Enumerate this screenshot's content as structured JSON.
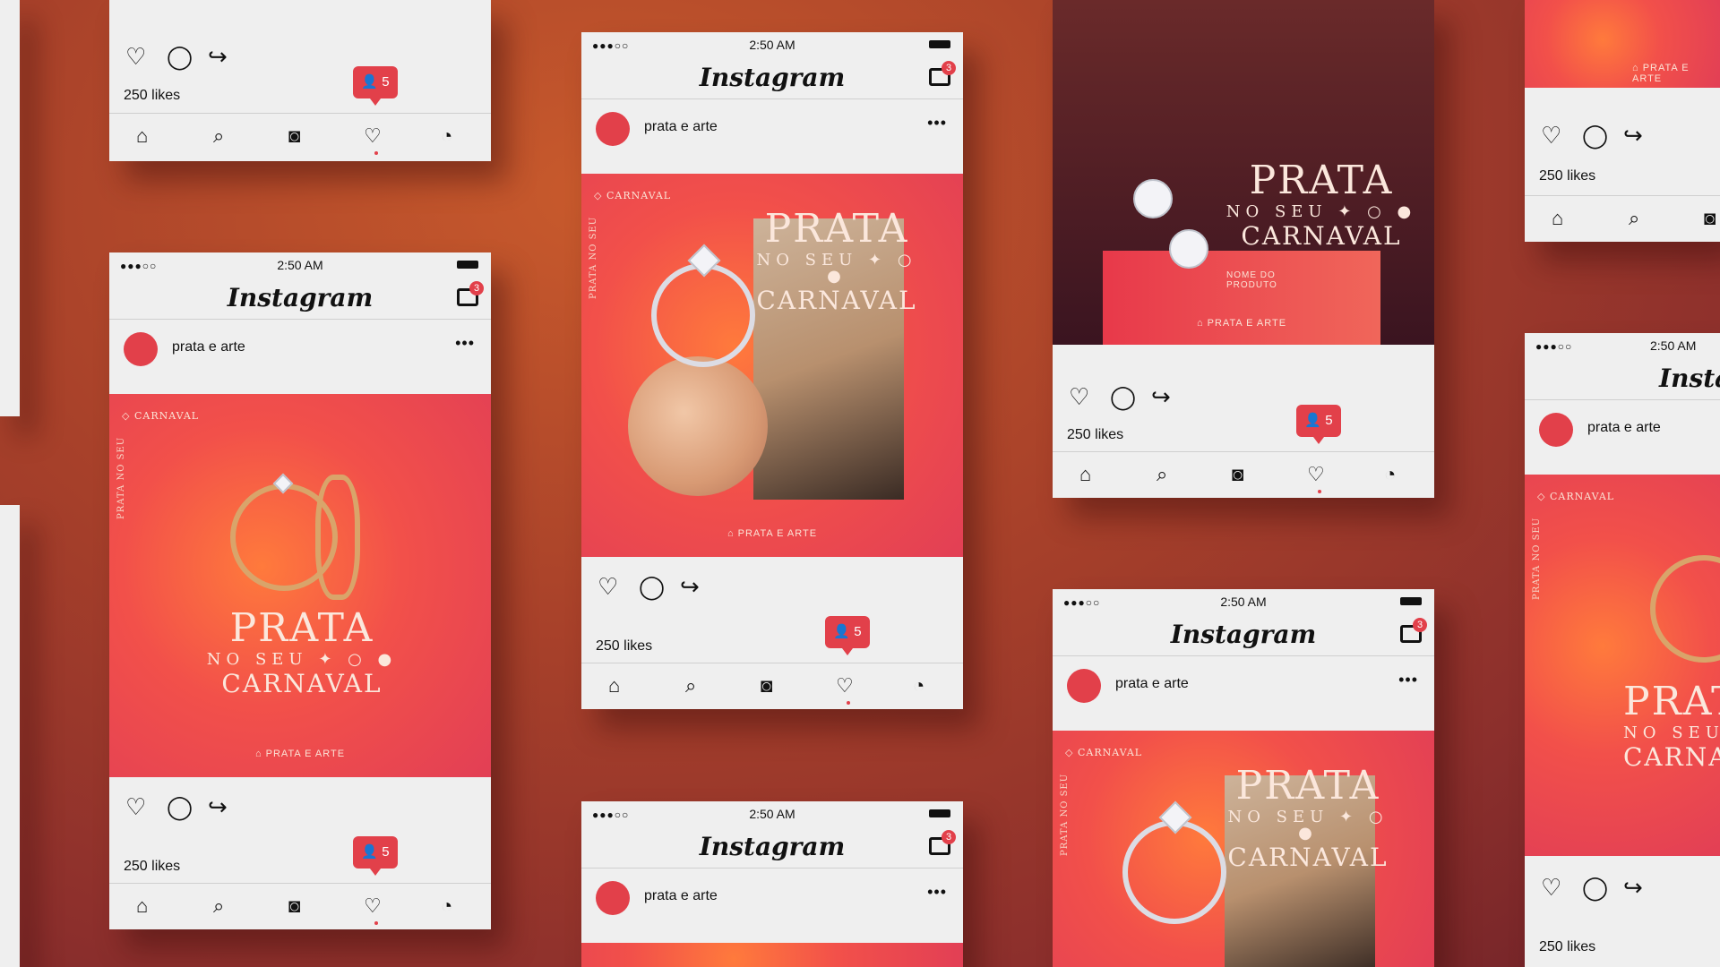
{
  "status": {
    "time": "2:50 AM",
    "signal": "●●●○○"
  },
  "app": {
    "name": "Instagram",
    "inbox_badge": "3"
  },
  "post": {
    "username": "prata e arte",
    "likes": "250 likes",
    "notif_count": "5"
  },
  "creative": {
    "title": "PRATA",
    "subtitle": "NO SEU ✦ ○ ●",
    "title2": "CARNAVAL",
    "side": "PRATA NO SEU",
    "corner": "◇ CARNAVAL",
    "brand": "⌂ PRATA E ARTE",
    "product": "NOME DO PRODUTO"
  },
  "icons": {
    "heart": "heart-icon",
    "comment": "comment-icon",
    "share": "share-icon",
    "home": "home-icon",
    "search": "search-icon",
    "camera": "camera-icon",
    "activity": "heart-icon",
    "profile": "profile-icon",
    "inbox": "inbox-icon",
    "more": "more-icon"
  },
  "colors": {
    "accent": "#e2404a"
  }
}
